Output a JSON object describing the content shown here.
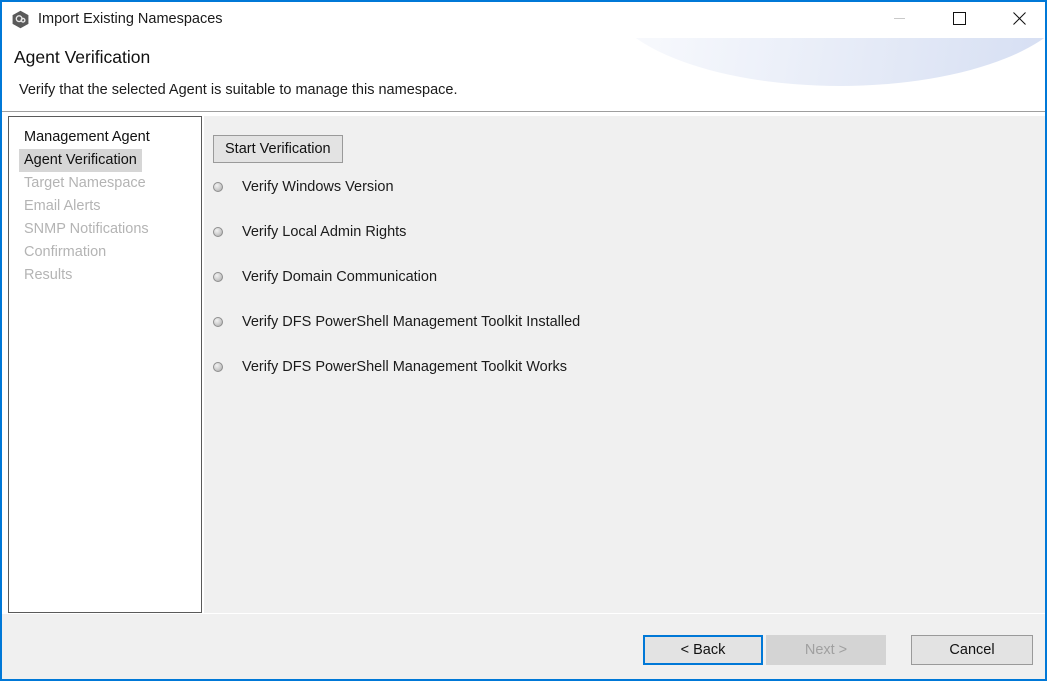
{
  "window": {
    "title": "Import Existing Namespaces",
    "icon": "hexagon-app-icon",
    "accent_color": "#0078d7",
    "controls": {
      "minimize_label": "—",
      "maximize_label": "☐",
      "close_label": "✕"
    }
  },
  "header": {
    "title": "Agent Verification",
    "subtitle": "Verify that the selected Agent is suitable to manage this namespace."
  },
  "sidebar": {
    "items": [
      {
        "label": "Management Agent",
        "state": "enabled"
      },
      {
        "label": "Agent Verification",
        "state": "selected"
      },
      {
        "label": "Target Namespace",
        "state": "disabled"
      },
      {
        "label": "Email Alerts",
        "state": "disabled"
      },
      {
        "label": "SNMP Notifications",
        "state": "disabled"
      },
      {
        "label": "Confirmation",
        "state": "disabled"
      },
      {
        "label": "Results",
        "state": "disabled"
      }
    ],
    "selected_background": "#d6d6d6",
    "disabled_color": "#b4b4b4"
  },
  "content": {
    "start_button_label": "Start Verification",
    "checks": [
      {
        "label": "Verify Windows Version",
        "status": "pending"
      },
      {
        "label": "Verify Local Admin Rights",
        "status": "pending"
      },
      {
        "label": "Verify Domain Communication",
        "status": "pending"
      },
      {
        "label": "Verify DFS PowerShell Management Toolkit Installed",
        "status": "pending"
      },
      {
        "label": "Verify DFS PowerShell Management Toolkit Works",
        "status": "pending"
      }
    ]
  },
  "footer": {
    "back_label": "< Back",
    "next_label": "Next >",
    "cancel_label": "Cancel",
    "next_enabled": false,
    "focused_button": "back"
  }
}
